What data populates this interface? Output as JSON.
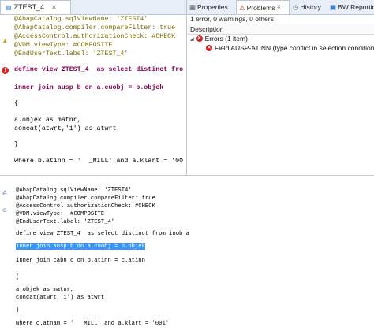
{
  "editor": {
    "tab_title": "ZTEST_4",
    "lines": [
      "@AbapCatalog.sqlViewName: 'ZTEST4'",
      "@AbapCatalog.compiler.compareFilter: true",
      "@AccessControl.authorizationCheck: #CHECK",
      "@VDM.viewType: #COMPOSITE",
      "@EndUserText.label: 'ZTEST_4'",
      "define view ZTEST_4  as select distinct fro",
      "inner join ausp b on a.cuobj = b.objek",
      "{",
      "a.objek as matnr,",
      "concat(atwrt,'1') as atwrt",
      "}",
      "where b.atinn = '  _MILL' and a.klart = '00"
    ]
  },
  "problems": {
    "tabs": [
      "Properties",
      "Problems",
      "History",
      "BW Reporting Prev"
    ],
    "summary": "1 error, 0 warnings, 0 others",
    "column_header": "Description",
    "group_label": "Errors (1 item)",
    "error_text": "Field AUSP-ATINN (type conflict in selection condition)"
  },
  "lower": {
    "lines": [
      "@AbapCatalog.sqlViewName: 'ZTEST4'",
      "@AbapCatalog.compiler.compareFilter: true",
      "@AccessControl.authorizationCheck: #CHECK",
      "@VDM.viewType:  #COMPOSITE",
      "@EndUserText.label: 'ZTEST_4'",
      "define view ZTEST_4  as select distinct from inob a",
      "inner join ausp b on a.cuobj = b.objek",
      "inner join cabn c on b.atinn = c.atinn",
      "(",
      "a.objek as matnr,",
      "concat(atwrt,'1') as atwrt",
      ")",
      "where c.atnam = '   MILL' and a.klart = '001'"
    ]
  }
}
